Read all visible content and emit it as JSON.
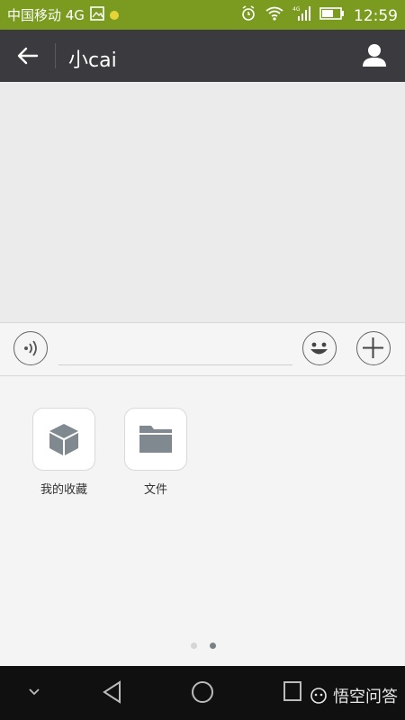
{
  "status": {
    "carrier": "中国移动 4G",
    "time": "12:59",
    "net": "4G"
  },
  "header": {
    "title": "小cai"
  },
  "panel": {
    "items": [
      {
        "label": "我的收藏",
        "icon": "cube-icon"
      },
      {
        "label": "文件",
        "icon": "folder-icon"
      }
    ],
    "page_dots": {
      "count": 2,
      "active_index": 1
    }
  },
  "watermark": {
    "text": "悟空问答"
  },
  "colors": {
    "status_bar": "#7a9b1f",
    "header": "#3a3a3f",
    "nav": "#101010",
    "icon_gray": "#808890"
  }
}
